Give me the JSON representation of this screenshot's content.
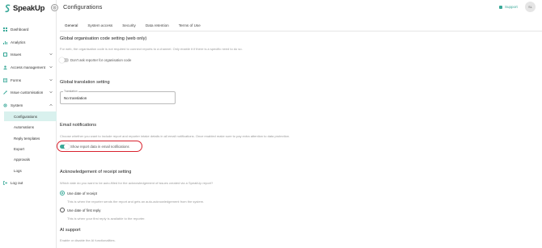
{
  "app": {
    "brand": "SpeakUp"
  },
  "header": {
    "title": "Configurations",
    "support_label": "Support",
    "avatar_initials": "SL"
  },
  "sidebar": {
    "items": [
      {
        "label": "Dashboard",
        "icon": "dashboard-icon"
      },
      {
        "label": "Analytics",
        "icon": "analytics-icon"
      },
      {
        "label": "Issues",
        "icon": "issues-icon"
      },
      {
        "label": "Access management",
        "icon": "access-icon"
      },
      {
        "label": "Forms",
        "icon": "forms-icon"
      },
      {
        "label": "Issue customisation",
        "icon": "customisation-icon"
      },
      {
        "label": "System",
        "icon": "system-icon"
      }
    ],
    "system_subitems": [
      {
        "label": "Configurations",
        "active": true
      },
      {
        "label": "Automations"
      },
      {
        "label": "Reply templates"
      },
      {
        "label": "Export"
      },
      {
        "label": "Approvals"
      },
      {
        "label": "Logs"
      }
    ],
    "logout_label": "Log out"
  },
  "tabs": [
    {
      "label": "General",
      "active": true
    },
    {
      "label": "System access"
    },
    {
      "label": "Security"
    },
    {
      "label": "Data retention"
    },
    {
      "label": "Terms of Use"
    }
  ],
  "sections": {
    "org_code": {
      "title": "Global organisation code setting (web only)",
      "desc": "For web, the organisation code is not required to connect reports to a channel. Only enable it if there is a specific need to do so.",
      "toggle_label": "Don't ask reporter for organisation code",
      "toggle_on": false
    },
    "translation": {
      "title": "Global translation setting",
      "field_label": "Translation",
      "field_value": "No translation"
    },
    "email": {
      "title": "Email notifications",
      "desc": "Choose whether you want to include report and reporter intake details in all email notifications. Once enabled make sure to pay extra attention to data protection.",
      "toggle_label": "Show report data in email notifications",
      "toggle_on": true,
      "highlight_color": "#d9232e"
    },
    "ack": {
      "title": "Acknowledgement of receipt setting",
      "desc": "Which date do you want to be auto-filled for the acknowledgement of issues created via a SpeakUp report?",
      "options": [
        {
          "label": "Use date of receipt",
          "hint": "This is when the reporter sends the report and gets an auto-acknowledgement from the system.",
          "selected": true
        },
        {
          "label": "Use date of first reply",
          "hint": "This is when your first reply is available to the reporter.",
          "selected": false
        }
      ]
    },
    "ai": {
      "title": "AI support",
      "desc": "Enable or disable the AI functionalities."
    }
  },
  "colors": {
    "accent": "#3aa999",
    "active_bg": "#d9f1ee"
  }
}
